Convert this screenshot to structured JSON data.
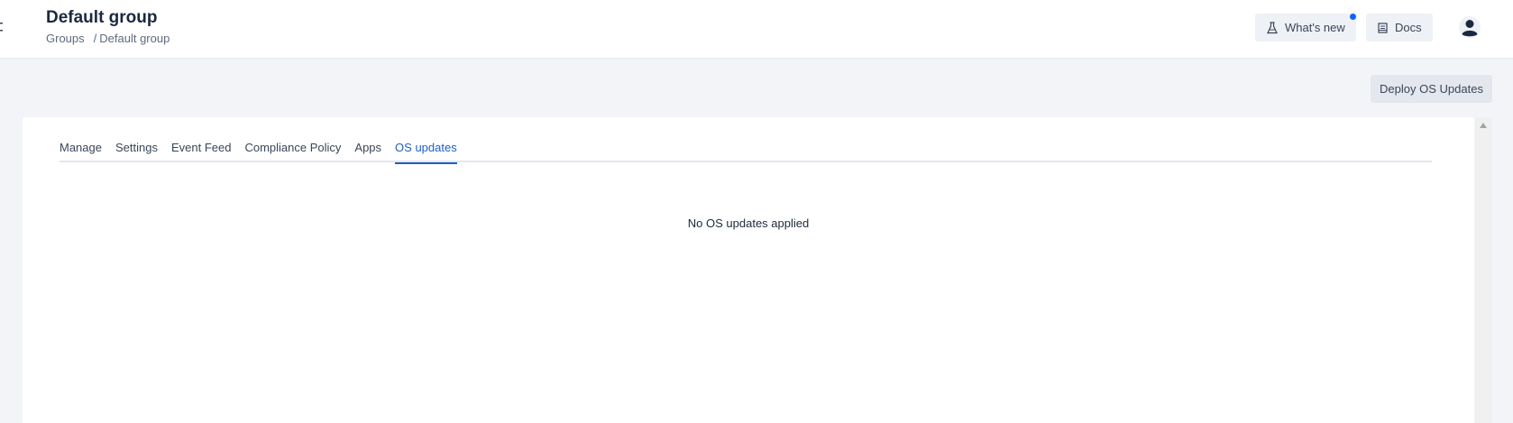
{
  "header": {
    "title": "Default group",
    "breadcrumb": {
      "parent": "Groups",
      "separator": "/",
      "current": "Default group"
    },
    "whats_new_label": "What's new",
    "docs_label": "Docs",
    "notification_dot_color": "#0f62fe"
  },
  "actions": {
    "deploy_label": "Deploy OS Updates"
  },
  "tabs": [
    {
      "label": "Manage"
    },
    {
      "label": "Settings"
    },
    {
      "label": "Event Feed"
    },
    {
      "label": "Compliance Policy"
    },
    {
      "label": "Apps"
    },
    {
      "label": "OS updates",
      "active": true
    }
  ],
  "main": {
    "empty_message": "No OS updates applied"
  },
  "icons": {
    "whats_new": "flask-icon",
    "docs": "book-icon",
    "user": "user-avatar-icon"
  },
  "colors": {
    "accent": "#1f5fc4"
  }
}
